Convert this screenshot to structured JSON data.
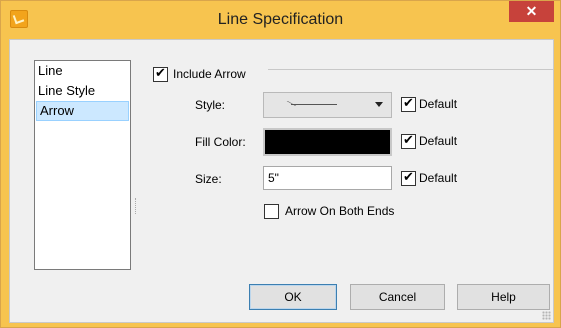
{
  "window": {
    "title": "Line Specification",
    "close_glyph": "✕"
  },
  "nav": {
    "items": [
      "Line",
      "Line Style",
      "Arrow"
    ],
    "selected": "Arrow"
  },
  "include_arrow": {
    "label": "Include Arrow",
    "checked": true
  },
  "style": {
    "label": "Style:",
    "default_label": "Default",
    "default_checked": true
  },
  "fill_color": {
    "label": "Fill Color:",
    "value_color": "#000000",
    "default_label": "Default",
    "default_checked": true
  },
  "size": {
    "label": "Size:",
    "value": "5\"",
    "default_label": "Default",
    "default_checked": true
  },
  "both_ends": {
    "label": "Arrow On Both Ends",
    "checked": false
  },
  "buttons": {
    "ok": "OK",
    "cancel": "Cancel",
    "help": "Help"
  },
  "check_glyph": "✔"
}
